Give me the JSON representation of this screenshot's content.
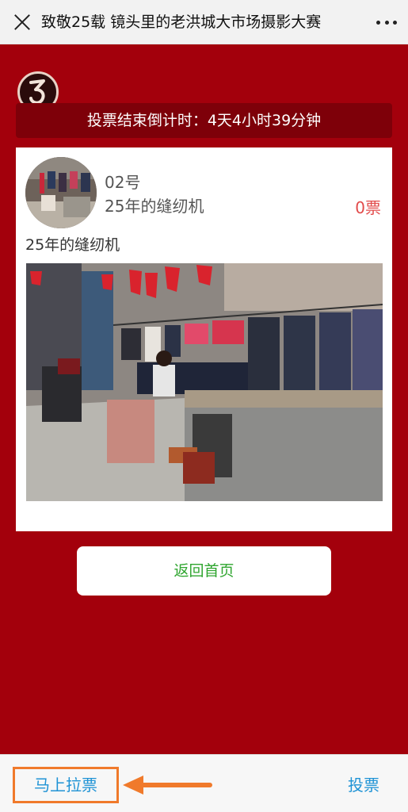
{
  "header": {
    "title": "致敬25载 镜头里的老洪城大市场摄影大赛"
  },
  "countdown": {
    "text": "投票结束倒计时：4天4小时39分钟"
  },
  "entry": {
    "number": "02号",
    "title": "25年的缝纫机",
    "votes": "0票",
    "description": "25年的缝纫机"
  },
  "actions": {
    "home_label": "返回首页"
  },
  "footer": {
    "canvass_label": "马上拉票",
    "vote_label": "投票"
  },
  "colors": {
    "background": "#a3000c",
    "countdown_bg": "#7e0009",
    "accent_green": "#2fa52f",
    "accent_blue": "#1f93d5",
    "highlight_orange": "#f07a2b",
    "vote_red": "#e24b4b"
  }
}
